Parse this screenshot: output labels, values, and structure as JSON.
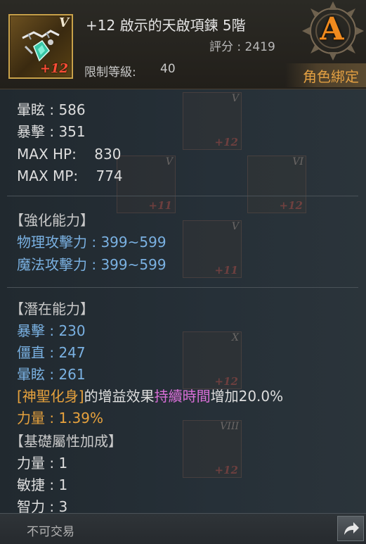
{
  "item": {
    "icon_tier": "V",
    "icon_plus": "+12",
    "title": "+12 啟示的天啟項鍊 5階",
    "score": "評分 : 2419",
    "level_label": "限制等級:",
    "level_value": "40",
    "grade": "A",
    "bind": "角色綁定"
  },
  "base_stats": [
    "暈眩 : 586",
    "暴擊 : 351",
    "MAX HP:    830",
    "MAX MP:    774"
  ],
  "enhance": {
    "header": "【強化能力】",
    "lines": [
      "物理攻擊力 : 399~599",
      "魔法攻擊力 : 399~599"
    ]
  },
  "potential": {
    "header": "【潛在能力】",
    "lines": [
      "暴擊 : 230",
      "僵直 : 247",
      "暈眩 : 261"
    ],
    "skill_name": "[神聖化身]",
    "skill_mid": "的增益效果",
    "skill_key": "持續時間",
    "skill_end": "增加20.0%",
    "strength": "力量 : 1.39%"
  },
  "attributes": {
    "header": "【基礎屬性加成】",
    "lines": [
      "力量 : 1",
      "敏捷 : 1",
      "智力 : 3"
    ]
  },
  "ghost_items": [
    {
      "tier": "V",
      "plus": "+12"
    },
    {
      "tier": "V",
      "plus": "+11"
    },
    {
      "tier": "VI",
      "plus": "+12"
    },
    {
      "tier": "V",
      "plus": "+11"
    },
    {
      "tier": "X",
      "plus": "+12"
    },
    {
      "tier": "VIII",
      "plus": "+12"
    }
  ],
  "footer": {
    "trade": "不可交易"
  },
  "colors": {
    "accent_orange": "#e7a23d",
    "enhance_blue": "#7ab1e2",
    "highlight_pink": "#d96fd8",
    "grade_orange": "#f08a1e",
    "plus_red": "#ff4d36"
  },
  "icons": [
    "necklace-item-icon",
    "grade-badge-icon",
    "share-arrow-icon"
  ]
}
